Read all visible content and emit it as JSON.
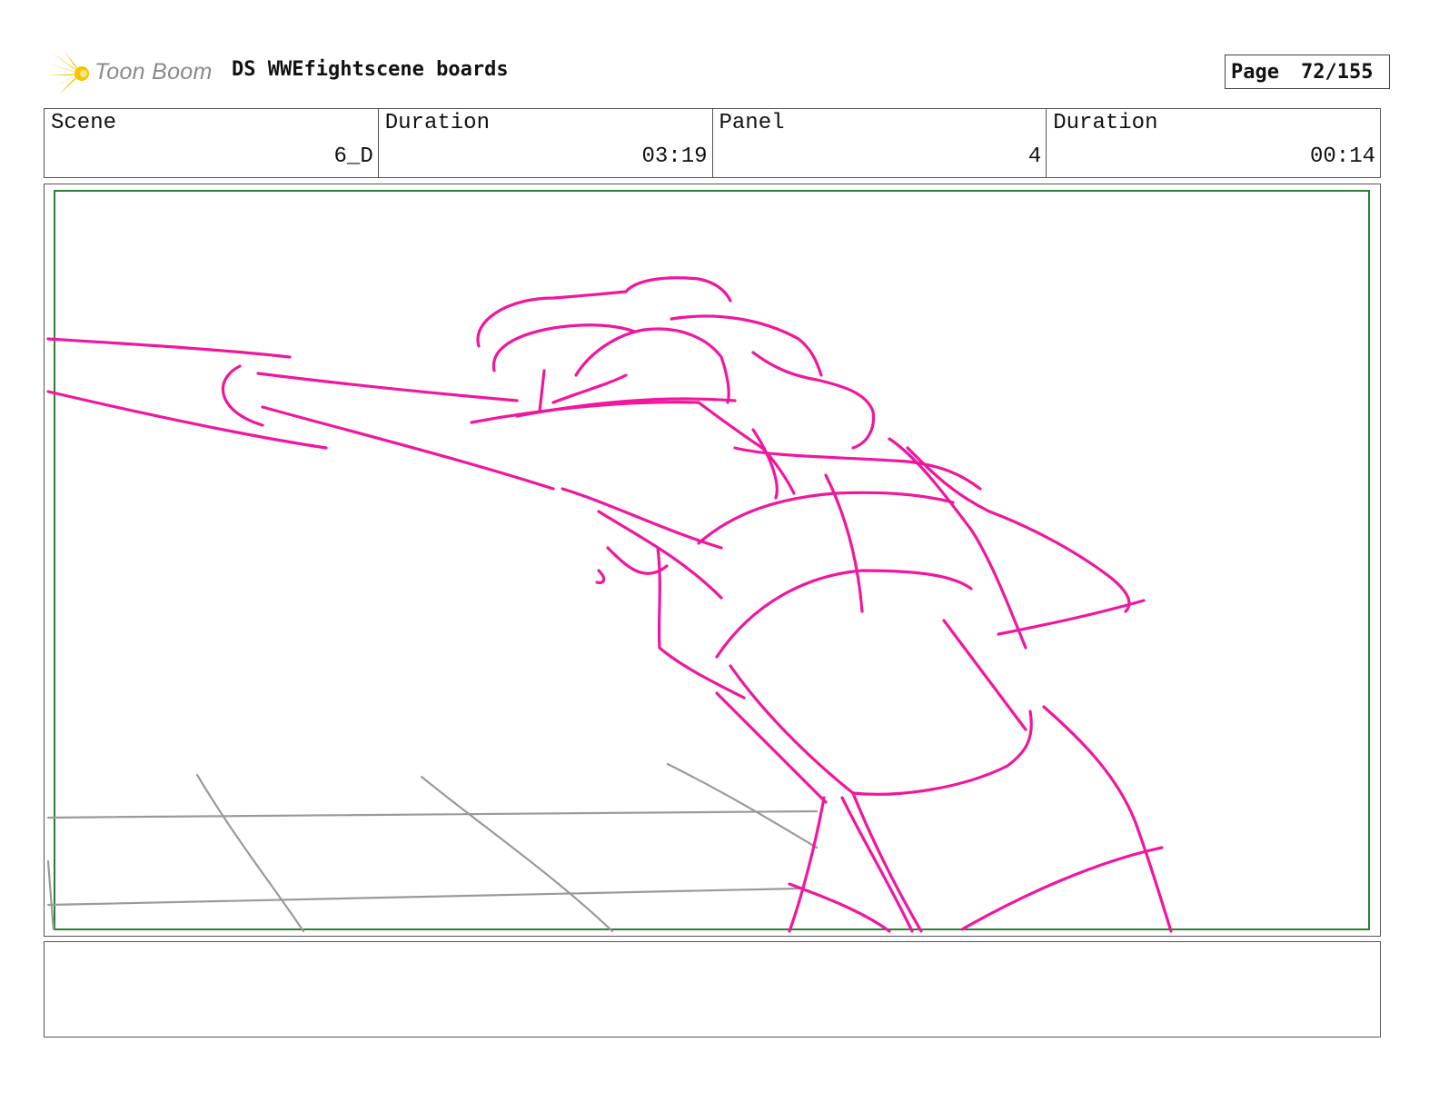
{
  "header": {
    "logo_text": "Toon Boom",
    "title": "DS WWEfightscene boards",
    "page_label": "Page",
    "page_value": "72/155"
  },
  "info": [
    {
      "label": "Scene",
      "value": "6_D"
    },
    {
      "label": "Duration",
      "value": "03:19"
    },
    {
      "label": "Panel",
      "value": "4"
    },
    {
      "label": "Duration",
      "value": "00:14"
    }
  ],
  "colors": {
    "sketch": "#f0169e",
    "ropes": "#9a9a9a",
    "safe_frame": "#2e7d32",
    "logo_star": "#f7c400"
  },
  "notes": {
    "text": ""
  }
}
